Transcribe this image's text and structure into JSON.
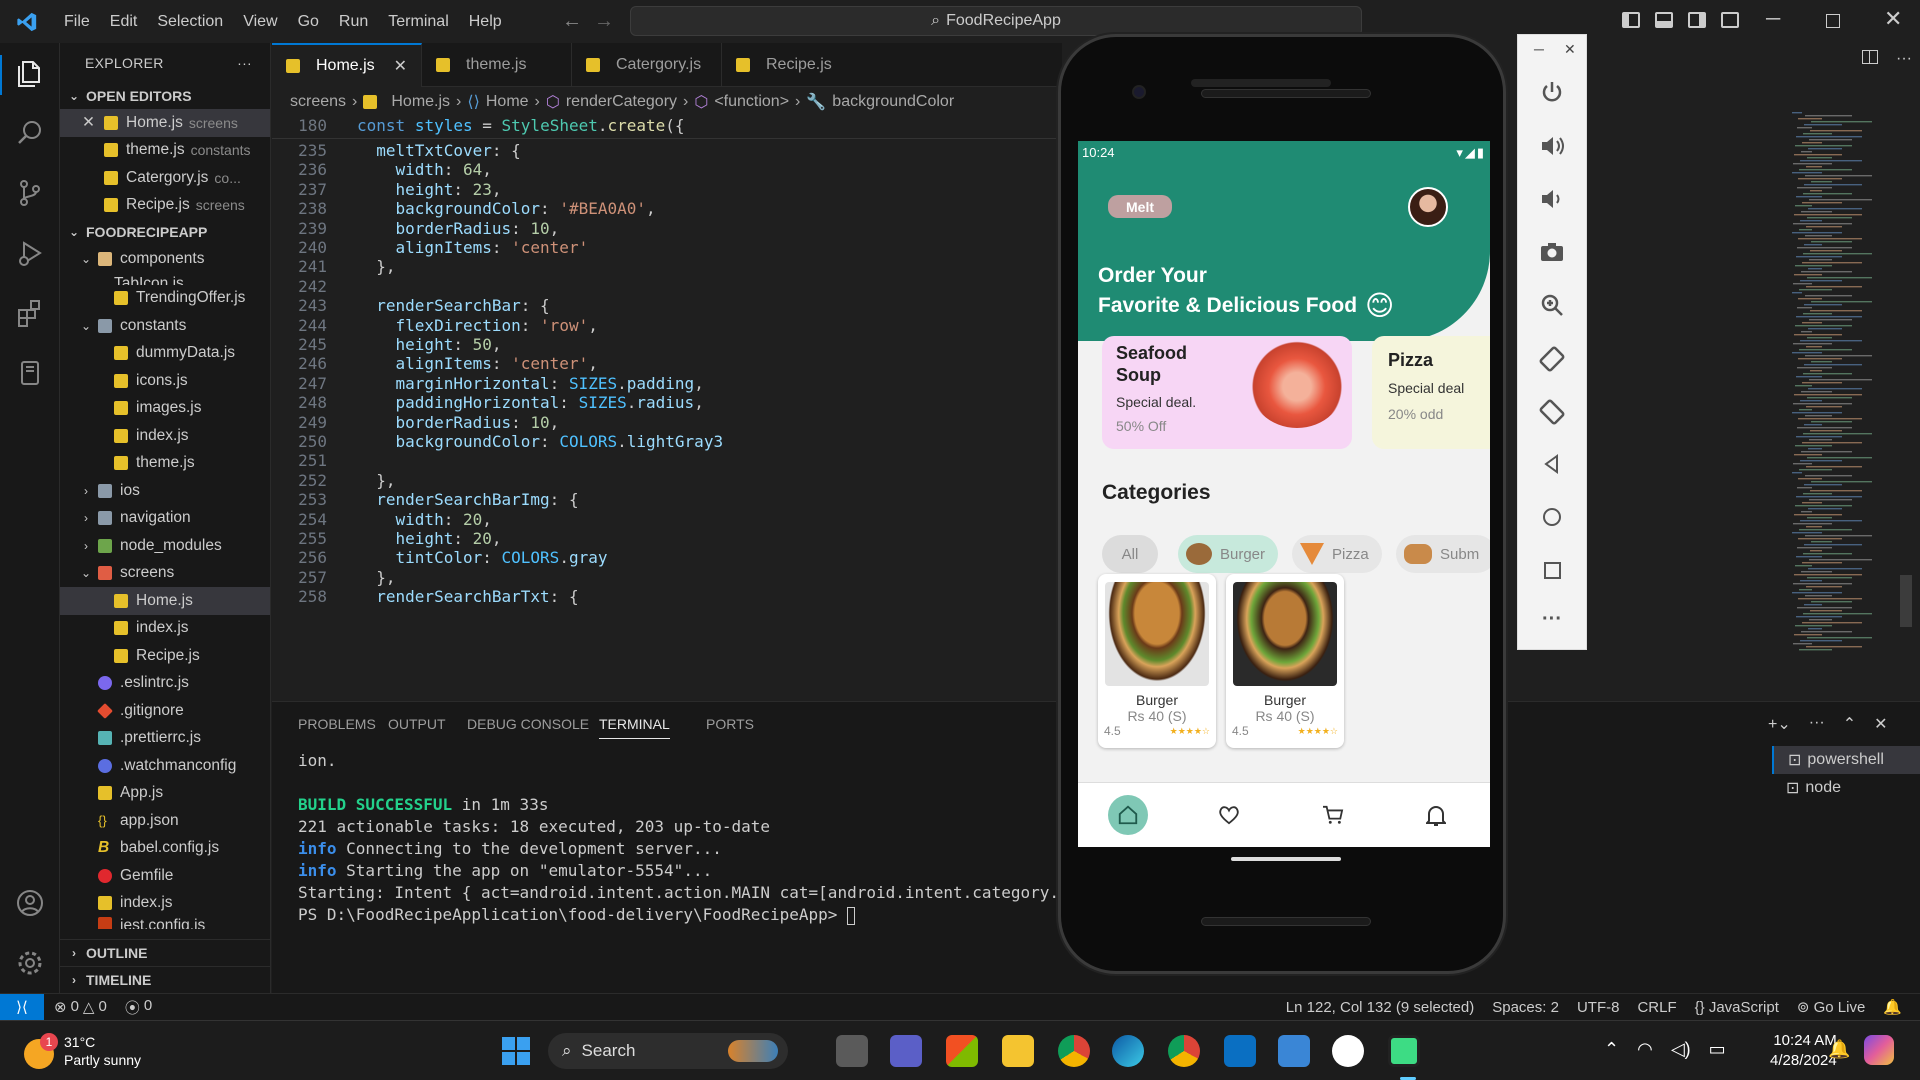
{
  "titlebar": {
    "menus": [
      "File",
      "Edit",
      "Selection",
      "View",
      "Go",
      "Run",
      "Terminal",
      "Help"
    ],
    "search": "FoodRecipeApp"
  },
  "explorer": {
    "title": "EXPLORER",
    "open_editors_label": "OPEN EDITORS",
    "open_editors": [
      {
        "name": "Home.js",
        "folder": "screens"
      },
      {
        "name": "theme.js",
        "folder": "constants"
      },
      {
        "name": "Catergory.js",
        "folder": "co..."
      },
      {
        "name": "Recipe.js",
        "folder": "screens"
      }
    ],
    "project_label": "FOODRECIPEAPP",
    "tree": {
      "components": "components",
      "tabicon": "TabIcon.js",
      "trending": "TrendingOffer.js",
      "constants": "constants",
      "dummy": "dummyData.js",
      "icons": "icons.js",
      "images": "images.js",
      "index1": "index.js",
      "theme": "theme.js",
      "ios": "ios",
      "navigation": "navigation",
      "node_modules": "node_modules",
      "screens": "screens",
      "home": "Home.js",
      "index2": "index.js",
      "recipe": "Recipe.js",
      "eslint": ".eslintrc.js",
      "gitignore": ".gitignore",
      "prettier": ".prettierrc.js",
      "watchman": ".watchmanconfig",
      "app": "App.js",
      "appjson": "app.json",
      "babel": "babel.config.js",
      "gemfile": "Gemfile",
      "index3": "index.js",
      "jest": "jest.config.js"
    },
    "outline": "OUTLINE",
    "timeline": "TIMELINE"
  },
  "tabs": [
    "Home.js",
    "theme.js",
    "Catergory.js",
    "Recipe.js"
  ],
  "breadcrumb": [
    "screens",
    "Home.js",
    "Home",
    "renderCategory",
    "<function>",
    "backgroundColor"
  ],
  "code": {
    "sticky_ln": "180",
    "sticky": "const styles = StyleSheet.create({",
    "lines": [
      [
        "235",
        "  meltTxtCover: {"
      ],
      [
        "236",
        "    width: 64,"
      ],
      [
        "237",
        "    height: 23,"
      ],
      [
        "238",
        "    backgroundColor: '#BEA0A0',"
      ],
      [
        "239",
        "    borderRadius: 10,"
      ],
      [
        "240",
        "    alignItems: 'center'"
      ],
      [
        "241",
        "  },"
      ],
      [
        "242",
        ""
      ],
      [
        "243",
        "  renderSearchBar: {"
      ],
      [
        "244",
        "    flexDirection: 'row',"
      ],
      [
        "245",
        "    height: 50,"
      ],
      [
        "246",
        "    alignItems: 'center',"
      ],
      [
        "247",
        "    marginHorizontal: SIZES.padding,"
      ],
      [
        "248",
        "    paddingHorizontal: SIZES.radius,"
      ],
      [
        "249",
        "    borderRadius: 10,"
      ],
      [
        "250",
        "    backgroundColor: COLORS.lightGray3"
      ],
      [
        "251",
        ""
      ],
      [
        "252",
        "  },"
      ],
      [
        "253",
        "  renderSearchBarImg: {"
      ],
      [
        "254",
        "    width: 20,"
      ],
      [
        "255",
        "    height: 20,"
      ],
      [
        "256",
        "    tintColor: COLORS.gray"
      ],
      [
        "257",
        "  },"
      ],
      [
        "258",
        "  renderSearchBarTxt: {"
      ]
    ]
  },
  "panel": {
    "tabs": [
      "PROBLEMS",
      "OUTPUT",
      "DEBUG CONSOLE",
      "TERMINAL",
      "PORTS"
    ],
    "terminal": {
      "l1": "ion.",
      "build_ok": "BUILD SUCCESSFUL",
      "build_time": " in 1m 33s",
      "l3": "221 actionable tasks: 18 executed, 203 up-to-date",
      "info": "info",
      "l4": " Connecting to the development server...",
      "l5": " Starting the app on \"emulator-5554\"...",
      "l6": "Starting: Intent { act=android.intent.action.MAIN cat=[android.intent.category.LAUNCH",
      "prompt": "PS D:\\FoodRecipeApplication\\food-delivery\\FoodRecipeApp> "
    },
    "term_list": [
      "powershell",
      "node"
    ]
  },
  "status": {
    "errors": "0",
    "warnings": "0",
    "ports": "0",
    "position": "Ln 122, Col 132 (9 selected)",
    "spaces": "Spaces: 2",
    "encoding": "UTF-8",
    "eol": "CRLF",
    "language": "JavaScript",
    "golive": "Go Live"
  },
  "phone": {
    "time": "10:24",
    "melt": "Melt",
    "headline1": "Order Your",
    "headline2": "Favorite & Delicious Food",
    "emoji": "😊",
    "promo1_title": "Seafood Soup",
    "promo1_sub": "Special deal.",
    "promo1_off": "50% Off",
    "promo2_title": "Pizza",
    "promo2_sub": "Special deal",
    "promo2_off": "20% odd",
    "categories_title": "Categories",
    "chips": [
      "All",
      "Burger",
      "Pizza",
      "Subm"
    ],
    "foods": [
      {
        "name": "Burger",
        "price": "Rs 40 (S)",
        "rating": "4.5"
      },
      {
        "name": "Burger",
        "price": "Rs 40 (S)",
        "rating": "4.5"
      }
    ]
  },
  "taskbar": {
    "temp": "31°C",
    "weather": "Partly sunny",
    "search": "Search",
    "time": "10:24 AM",
    "date": "4/28/2024",
    "notif": "1"
  },
  "colors": {
    "accent": "#0078d4",
    "phone_header": "#1f8b73"
  }
}
